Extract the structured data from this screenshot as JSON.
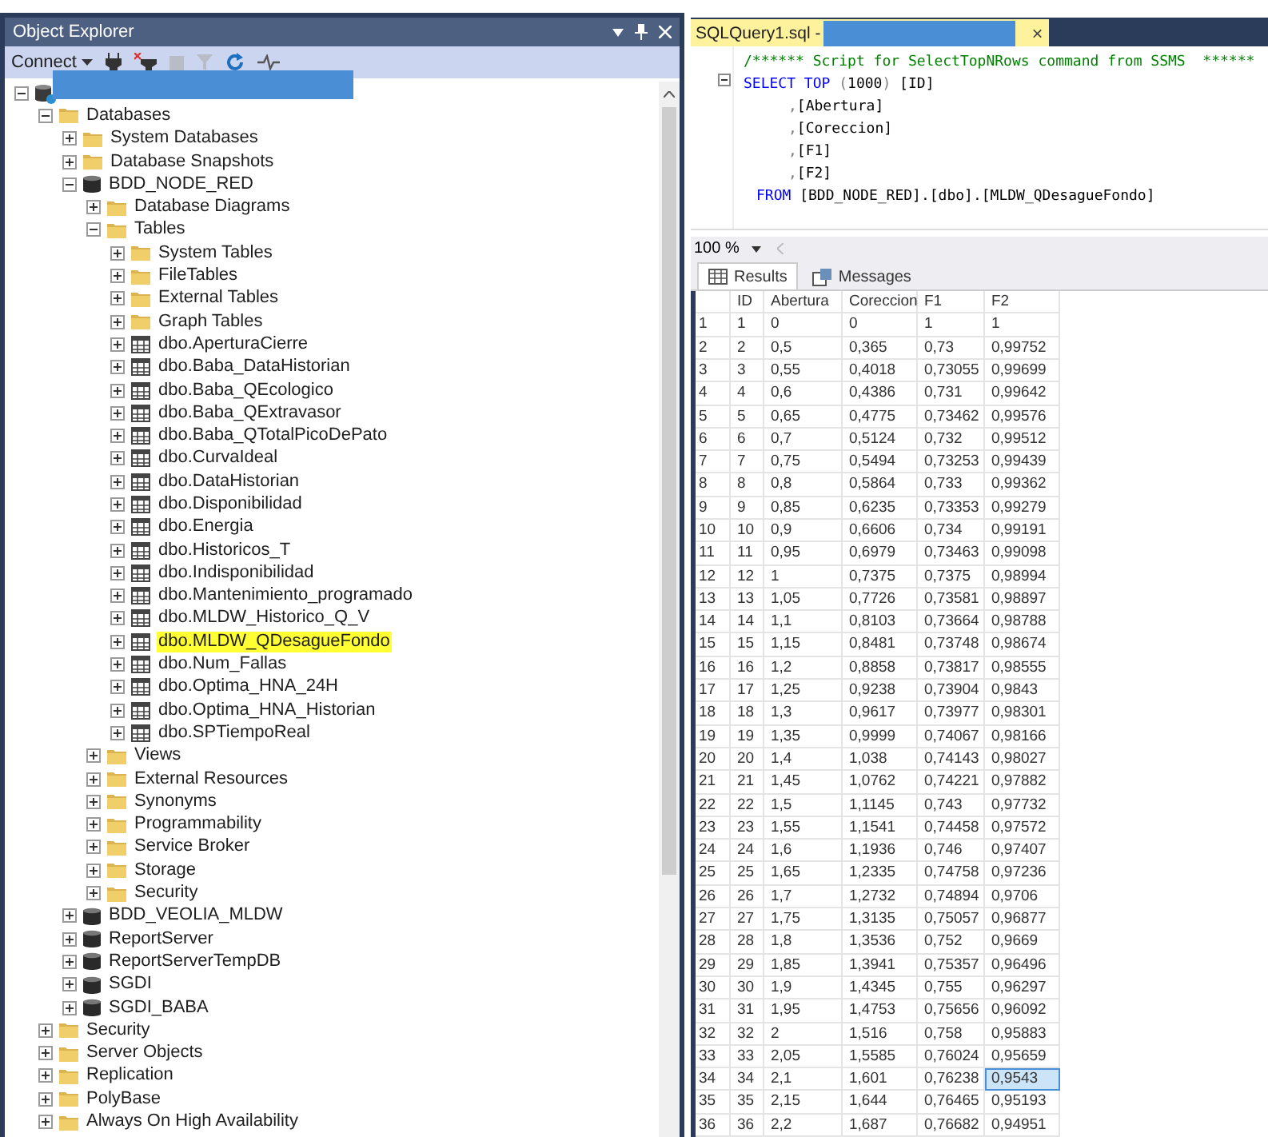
{
  "object_explorer": {
    "title": "Object Explorer",
    "toolbar": {
      "connect": "Connect"
    },
    "tree": [
      {
        "kind": "server",
        "expanded": true,
        "children": [
          {
            "kind": "folder",
            "label": "Databases",
            "expanded": true,
            "children": [
              {
                "kind": "folder",
                "label": "System Databases",
                "expanded": false
              },
              {
                "kind": "folder",
                "label": "Database Snapshots",
                "expanded": false
              },
              {
                "kind": "database",
                "label": "BDD_NODE_RED",
                "expanded": true,
                "children": [
                  {
                    "kind": "folder",
                    "label": "Database Diagrams",
                    "expanded": false
                  },
                  {
                    "kind": "folder",
                    "label": "Tables",
                    "expanded": true,
                    "children": [
                      {
                        "kind": "folder",
                        "label": "System Tables",
                        "expanded": false,
                        "highlighted": false
                      },
                      {
                        "kind": "folder",
                        "label": "FileTables",
                        "expanded": false,
                        "highlighted": false
                      },
                      {
                        "kind": "folder",
                        "label": "External Tables",
                        "expanded": false,
                        "highlighted": false
                      },
                      {
                        "kind": "folder",
                        "label": "Graph Tables",
                        "expanded": false,
                        "highlighted": false
                      },
                      {
                        "kind": "table",
                        "label": "dbo.AperturaCierre",
                        "expanded": false,
                        "highlighted": false
                      },
                      {
                        "kind": "table",
                        "label": "dbo.Baba_DataHistorian",
                        "expanded": false,
                        "highlighted": false
                      },
                      {
                        "kind": "table",
                        "label": "dbo.Baba_QEcologico",
                        "expanded": false,
                        "highlighted": false
                      },
                      {
                        "kind": "table",
                        "label": "dbo.Baba_QExtravasor",
                        "expanded": false,
                        "highlighted": false
                      },
                      {
                        "kind": "table",
                        "label": "dbo.Baba_QTotalPicoDePato",
                        "expanded": false,
                        "highlighted": false
                      },
                      {
                        "kind": "table",
                        "label": "dbo.CurvaIdeal",
                        "expanded": false,
                        "highlighted": false
                      },
                      {
                        "kind": "table",
                        "label": "dbo.DataHistorian",
                        "expanded": false,
                        "highlighted": false
                      },
                      {
                        "kind": "table",
                        "label": "dbo.Disponibilidad",
                        "expanded": false,
                        "highlighted": false
                      },
                      {
                        "kind": "table",
                        "label": "dbo.Energia",
                        "expanded": false,
                        "highlighted": false
                      },
                      {
                        "kind": "table",
                        "label": "dbo.Historicos_T",
                        "expanded": false,
                        "highlighted": false
                      },
                      {
                        "kind": "table",
                        "label": "dbo.Indisponibilidad",
                        "expanded": false,
                        "highlighted": false
                      },
                      {
                        "kind": "table",
                        "label": "dbo.Mantenimiento_programado",
                        "expanded": false,
                        "highlighted": false
                      },
                      {
                        "kind": "table",
                        "label": "dbo.MLDW_Historico_Q_V",
                        "expanded": false,
                        "highlighted": false
                      },
                      {
                        "kind": "table",
                        "label": "dbo.MLDW_QDesagueFondo",
                        "expanded": false,
                        "highlighted": true
                      },
                      {
                        "kind": "table",
                        "label": "dbo.Num_Fallas",
                        "expanded": false,
                        "highlighted": false
                      },
                      {
                        "kind": "table",
                        "label": "dbo.Optima_HNA_24H",
                        "expanded": false,
                        "highlighted": false
                      },
                      {
                        "kind": "table",
                        "label": "dbo.Optima_HNA_Historian",
                        "expanded": false,
                        "highlighted": false
                      },
                      {
                        "kind": "table",
                        "label": "dbo.SPTiempoReal",
                        "expanded": false,
                        "highlighted": false
                      }
                    ]
                  },
                  {
                    "kind": "folder",
                    "label": "Views",
                    "expanded": false
                  },
                  {
                    "kind": "folder",
                    "label": "External Resources",
                    "expanded": false
                  },
                  {
                    "kind": "folder",
                    "label": "Synonyms",
                    "expanded": false
                  },
                  {
                    "kind": "folder",
                    "label": "Programmability",
                    "expanded": false
                  },
                  {
                    "kind": "folder",
                    "label": "Service Broker",
                    "expanded": false
                  },
                  {
                    "kind": "folder",
                    "label": "Storage",
                    "expanded": false
                  },
                  {
                    "kind": "folder",
                    "label": "Security",
                    "expanded": false
                  }
                ]
              },
              {
                "kind": "database",
                "label": "BDD_VEOLIA_MLDW",
                "expanded": false
              },
              {
                "kind": "database",
                "label": "ReportServer",
                "expanded": false
              },
              {
                "kind": "database",
                "label": "ReportServerTempDB",
                "expanded": false
              },
              {
                "kind": "database",
                "label": "SGDI",
                "expanded": false
              },
              {
                "kind": "database",
                "label": "SGDI_BABA",
                "expanded": false
              }
            ]
          },
          {
            "kind": "folder",
            "label": "Security",
            "expanded": false
          },
          {
            "kind": "folder",
            "label": "Server Objects",
            "expanded": false
          },
          {
            "kind": "folder",
            "label": "Replication",
            "expanded": false
          },
          {
            "kind": "folder",
            "label": "PolyBase",
            "expanded": false
          },
          {
            "kind": "folder",
            "label": "Always On High Availability",
            "expanded": false
          }
        ]
      }
    ]
  },
  "query": {
    "tab_title": "SQLQuery1.sql -",
    "close": "×",
    "code": [
      {
        "kind": "comment",
        "tokens": [
          {
            "kind": "comment",
            "text": "/****** Script for SelectTopNRows command from SSMS  ******"
          }
        ]
      },
      {
        "kind": "select",
        "tokens": [
          {
            "kind": "keyword",
            "text": "SELECT TOP "
          },
          {
            "kind": "punct",
            "text": "("
          },
          {
            "kind": "plain",
            "text": "1000"
          },
          {
            "kind": "punct",
            "text": ")"
          },
          {
            "kind": "plain",
            "text": " [ID]"
          }
        ]
      },
      {
        "kind": "column",
        "tokens": [
          {
            "kind": "punct",
            "text": ","
          },
          {
            "kind": "plain",
            "text": "[Abertura]"
          }
        ]
      },
      {
        "kind": "column",
        "tokens": [
          {
            "kind": "punct",
            "text": ","
          },
          {
            "kind": "plain",
            "text": "[Coreccion]"
          }
        ]
      },
      {
        "kind": "column",
        "tokens": [
          {
            "kind": "punct",
            "text": ","
          },
          {
            "kind": "plain",
            "text": "[F1]"
          }
        ]
      },
      {
        "kind": "column",
        "tokens": [
          {
            "kind": "punct",
            "text": ","
          },
          {
            "kind": "plain",
            "text": "[F2]"
          }
        ]
      },
      {
        "kind": "from",
        "tokens": [
          {
            "kind": "keyword",
            "text": "FROM "
          },
          {
            "kind": "plain",
            "text": "[BDD_NODE_RED].[dbo].[MLDW_QDesagueFondo]"
          }
        ]
      }
    ],
    "zoom": "100 %",
    "result_tabs": [
      {
        "label": "Results",
        "selected": true
      },
      {
        "label": "Messages",
        "selected": false
      }
    ],
    "grid": {
      "columns": [
        "ID",
        "Abertura",
        "Coreccion",
        "F1",
        "F2"
      ],
      "rows": [
        {
          "n": "1",
          "cells": [
            "1",
            "0",
            "0",
            "1",
            "1"
          ],
          "selected": [
            false,
            false,
            false,
            false,
            false
          ]
        },
        {
          "n": "2",
          "cells": [
            "2",
            "0,5",
            "0,365",
            "0,73",
            "0,99752"
          ],
          "selected": [
            false,
            false,
            false,
            false,
            false
          ]
        },
        {
          "n": "3",
          "cells": [
            "3",
            "0,55",
            "0,4018",
            "0,73055",
            "0,99699"
          ],
          "selected": [
            false,
            false,
            false,
            false,
            false
          ]
        },
        {
          "n": "4",
          "cells": [
            "4",
            "0,6",
            "0,4386",
            "0,731",
            "0,99642"
          ],
          "selected": [
            false,
            false,
            false,
            false,
            false
          ]
        },
        {
          "n": "5",
          "cells": [
            "5",
            "0,65",
            "0,4775",
            "0,73462",
            "0,99576"
          ],
          "selected": [
            false,
            false,
            false,
            false,
            false
          ]
        },
        {
          "n": "6",
          "cells": [
            "6",
            "0,7",
            "0,5124",
            "0,732",
            "0,99512"
          ],
          "selected": [
            false,
            false,
            false,
            false,
            false
          ]
        },
        {
          "n": "7",
          "cells": [
            "7",
            "0,75",
            "0,5494",
            "0,73253",
            "0,99439"
          ],
          "selected": [
            false,
            false,
            false,
            false,
            false
          ]
        },
        {
          "n": "8",
          "cells": [
            "8",
            "0,8",
            "0,5864",
            "0,733",
            "0,99362"
          ],
          "selected": [
            false,
            false,
            false,
            false,
            false
          ]
        },
        {
          "n": "9",
          "cells": [
            "9",
            "0,85",
            "0,6235",
            "0,73353",
            "0,99279"
          ],
          "selected": [
            false,
            false,
            false,
            false,
            false
          ]
        },
        {
          "n": "10",
          "cells": [
            "10",
            "0,9",
            "0,6606",
            "0,734",
            "0,99191"
          ],
          "selected": [
            false,
            false,
            false,
            false,
            false
          ]
        },
        {
          "n": "11",
          "cells": [
            "11",
            "0,95",
            "0,6979",
            "0,73463",
            "0,99098"
          ],
          "selected": [
            false,
            false,
            false,
            false,
            false
          ]
        },
        {
          "n": "12",
          "cells": [
            "12",
            "1",
            "0,7375",
            "0,7375",
            "0,98994"
          ],
          "selected": [
            false,
            false,
            false,
            false,
            false
          ]
        },
        {
          "n": "13",
          "cells": [
            "13",
            "1,05",
            "0,7726",
            "0,73581",
            "0,98897"
          ],
          "selected": [
            false,
            false,
            false,
            false,
            false
          ]
        },
        {
          "n": "14",
          "cells": [
            "14",
            "1,1",
            "0,8103",
            "0,73664",
            "0,98788"
          ],
          "selected": [
            false,
            false,
            false,
            false,
            false
          ]
        },
        {
          "n": "15",
          "cells": [
            "15",
            "1,15",
            "0,8481",
            "0,73748",
            "0,98674"
          ],
          "selected": [
            false,
            false,
            false,
            false,
            false
          ]
        },
        {
          "n": "16",
          "cells": [
            "16",
            "1,2",
            "0,8858",
            "0,73817",
            "0,98555"
          ],
          "selected": [
            false,
            false,
            false,
            false,
            false
          ]
        },
        {
          "n": "17",
          "cells": [
            "17",
            "1,25",
            "0,9238",
            "0,73904",
            "0,9843"
          ],
          "selected": [
            false,
            false,
            false,
            false,
            false
          ]
        },
        {
          "n": "18",
          "cells": [
            "18",
            "1,3",
            "0,9617",
            "0,73977",
            "0,98301"
          ],
          "selected": [
            false,
            false,
            false,
            false,
            false
          ]
        },
        {
          "n": "19",
          "cells": [
            "19",
            "1,35",
            "0,9999",
            "0,74067",
            "0,98166"
          ],
          "selected": [
            false,
            false,
            false,
            false,
            false
          ]
        },
        {
          "n": "20",
          "cells": [
            "20",
            "1,4",
            "1,038",
            "0,74143",
            "0,98027"
          ],
          "selected": [
            false,
            false,
            false,
            false,
            false
          ]
        },
        {
          "n": "21",
          "cells": [
            "21",
            "1,45",
            "1,0762",
            "0,74221",
            "0,97882"
          ],
          "selected": [
            false,
            false,
            false,
            false,
            false
          ]
        },
        {
          "n": "22",
          "cells": [
            "22",
            "1,5",
            "1,1145",
            "0,743",
            "0,97732"
          ],
          "selected": [
            false,
            false,
            false,
            false,
            false
          ]
        },
        {
          "n": "23",
          "cells": [
            "23",
            "1,55",
            "1,1541",
            "0,74458",
            "0,97572"
          ],
          "selected": [
            false,
            false,
            false,
            false,
            false
          ]
        },
        {
          "n": "24",
          "cells": [
            "24",
            "1,6",
            "1,1936",
            "0,746",
            "0,97407"
          ],
          "selected": [
            false,
            false,
            false,
            false,
            false
          ]
        },
        {
          "n": "25",
          "cells": [
            "25",
            "1,65",
            "1,2335",
            "0,74758",
            "0,97236"
          ],
          "selected": [
            false,
            false,
            false,
            false,
            false
          ]
        },
        {
          "n": "26",
          "cells": [
            "26",
            "1,7",
            "1,2732",
            "0,74894",
            "0,9706"
          ],
          "selected": [
            false,
            false,
            false,
            false,
            false
          ]
        },
        {
          "n": "27",
          "cells": [
            "27",
            "1,75",
            "1,3135",
            "0,75057",
            "0,96877"
          ],
          "selected": [
            false,
            false,
            false,
            false,
            false
          ]
        },
        {
          "n": "28",
          "cells": [
            "28",
            "1,8",
            "1,3536",
            "0,752",
            "0,9669"
          ],
          "selected": [
            false,
            false,
            false,
            false,
            false
          ]
        },
        {
          "n": "29",
          "cells": [
            "29",
            "1,85",
            "1,3941",
            "0,75357",
            "0,96496"
          ],
          "selected": [
            false,
            false,
            false,
            false,
            false
          ]
        },
        {
          "n": "30",
          "cells": [
            "30",
            "1,9",
            "1,4345",
            "0,755",
            "0,96297"
          ],
          "selected": [
            false,
            false,
            false,
            false,
            false
          ]
        },
        {
          "n": "31",
          "cells": [
            "31",
            "1,95",
            "1,4753",
            "0,75656",
            "0,96092"
          ],
          "selected": [
            false,
            false,
            false,
            false,
            false
          ]
        },
        {
          "n": "32",
          "cells": [
            "32",
            "2",
            "1,516",
            "0,758",
            "0,95883"
          ],
          "selected": [
            false,
            false,
            false,
            false,
            false
          ]
        },
        {
          "n": "33",
          "cells": [
            "33",
            "2,05",
            "1,5585",
            "0,76024",
            "0,95659"
          ],
          "selected": [
            false,
            false,
            false,
            false,
            false
          ]
        },
        {
          "n": "34",
          "cells": [
            "34",
            "2,1",
            "1,601",
            "0,76238",
            "0,9543"
          ],
          "selected": [
            false,
            false,
            false,
            false,
            true
          ]
        },
        {
          "n": "35",
          "cells": [
            "35",
            "2,15",
            "1,644",
            "0,76465",
            "0,95193"
          ],
          "selected": [
            false,
            false,
            false,
            false,
            false
          ]
        },
        {
          "n": "36",
          "cells": [
            "36",
            "2,2",
            "1,687",
            "0,76682",
            "0,94951"
          ],
          "selected": [
            false,
            false,
            false,
            false,
            false
          ]
        }
      ]
    }
  }
}
